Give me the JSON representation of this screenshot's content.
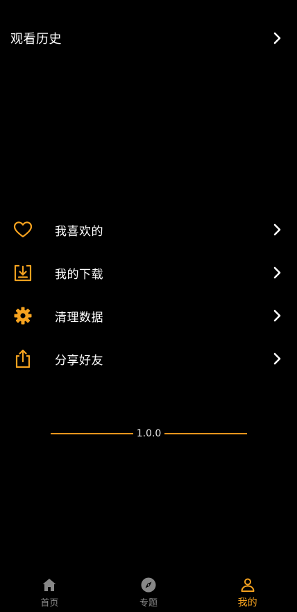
{
  "colors": {
    "accent": "#f5a21f",
    "background": "#000000",
    "text": "#ffffff",
    "inactive": "#888888"
  },
  "history": {
    "title": "观看历史",
    "icon": "chevron-right-icon"
  },
  "menu": {
    "items": [
      {
        "label": "我喜欢的",
        "icon": "heart-icon"
      },
      {
        "label": "我的下载",
        "icon": "download-icon"
      },
      {
        "label": "清理数据",
        "icon": "gear-icon"
      },
      {
        "label": "分享好友",
        "icon": "share-icon"
      }
    ]
  },
  "version": "1.0.0",
  "tabbar": {
    "tabs": [
      {
        "label": "首页",
        "icon": "home-icon",
        "active": false
      },
      {
        "label": "专题",
        "icon": "compass-icon",
        "active": false
      },
      {
        "label": "我的",
        "icon": "user-icon",
        "active": true
      }
    ]
  }
}
